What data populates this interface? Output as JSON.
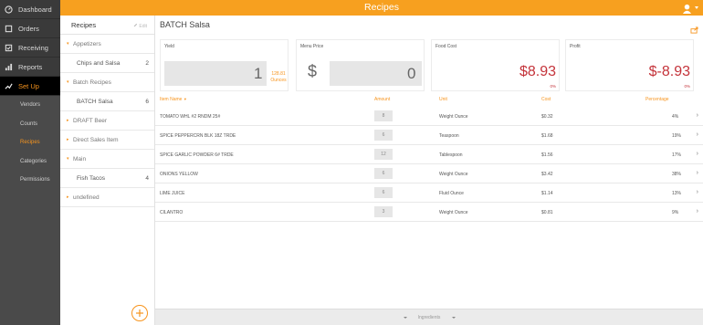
{
  "colors": {
    "accent": "#f7a01f",
    "negative": "#c4333a",
    "nav_bg": "#3a3a3a"
  },
  "nav": {
    "items": [
      {
        "label": "Dashboard",
        "icon": "dashboard-icon"
      },
      {
        "label": "Orders",
        "icon": "orders-icon"
      },
      {
        "label": "Receiving",
        "icon": "receiving-icon"
      },
      {
        "label": "Reports",
        "icon": "reports-icon"
      },
      {
        "label": "Set Up",
        "icon": "setup-icon"
      }
    ],
    "sub": [
      "Vendors",
      "Counts",
      "Recipes",
      "Categories",
      "Permissions"
    ]
  },
  "topbar": {
    "title": "Recipes",
    "user_icon": "user-icon"
  },
  "recipes_panel": {
    "title": "Recipes",
    "edit": "Edit",
    "rows": [
      {
        "kind": "cat",
        "label": "Appetizers",
        "arrow": "▾"
      },
      {
        "kind": "recipe",
        "label": "Chips and Salsa",
        "count": "2"
      },
      {
        "kind": "cat",
        "label": "Batch Recipes",
        "arrow": "▾"
      },
      {
        "kind": "recipe",
        "label": "BATCH Salsa",
        "count": "6"
      },
      {
        "kind": "cat",
        "label": "DRAFT Beer",
        "arrow": "▸"
      },
      {
        "kind": "cat",
        "label": "Direct Sales Item",
        "arrow": "▸"
      },
      {
        "kind": "cat",
        "label": "Main",
        "arrow": "▾"
      },
      {
        "kind": "recipe",
        "label": "Fish Tacos",
        "count": "4"
      },
      {
        "kind": "cat",
        "label": "undefined",
        "arrow": "▸"
      }
    ]
  },
  "main": {
    "title": "BATCH Salsa",
    "cards": {
      "yield": {
        "label": "Yield",
        "value": "1",
        "unit_line1": "128.81",
        "unit_line2": "Ounces"
      },
      "menu_price": {
        "label": "Menu Price",
        "currency": "$",
        "value": "0"
      },
      "food_cost": {
        "label": "Food Cost",
        "value": "$8.93",
        "pct": "0%"
      },
      "profit": {
        "label": "Profit",
        "value": "$-8.93",
        "pct": "0%"
      }
    },
    "table": {
      "headers": {
        "name": "Item Name",
        "amount": "Amount",
        "unit": "Unit",
        "cost": "Cost",
        "percentage": "Percentage"
      },
      "rows": [
        {
          "name": "TOMATO WHL #2 RNDM 25#",
          "amount": "8",
          "unit": "Weight Ounce",
          "cost": "$0.32",
          "pct": "4%"
        },
        {
          "name": "SPICE PEPPERCRN BLK 18Z TRDE",
          "amount": "6",
          "unit": "Teaspoon",
          "cost": "$1.68",
          "pct": "19%"
        },
        {
          "name": "SPICE GARLIC POWDER 6# TRDE",
          "amount": "12",
          "unit": "Tablespoon",
          "cost": "$1.56",
          "pct": "17%"
        },
        {
          "name": "ONIONS YELLOW",
          "amount": "6",
          "unit": "Weight Ounce",
          "cost": "$3.42",
          "pct": "38%"
        },
        {
          "name": "LIME JUICE",
          "amount": "6",
          "unit": "Fluid Ounce",
          "cost": "$1.14",
          "pct": "13%"
        },
        {
          "name": "CILANTRO",
          "amount": "3",
          "unit": "Weight Ounce",
          "cost": "$0.81",
          "pct": "9%"
        }
      ]
    },
    "footer": "Ingredients"
  }
}
